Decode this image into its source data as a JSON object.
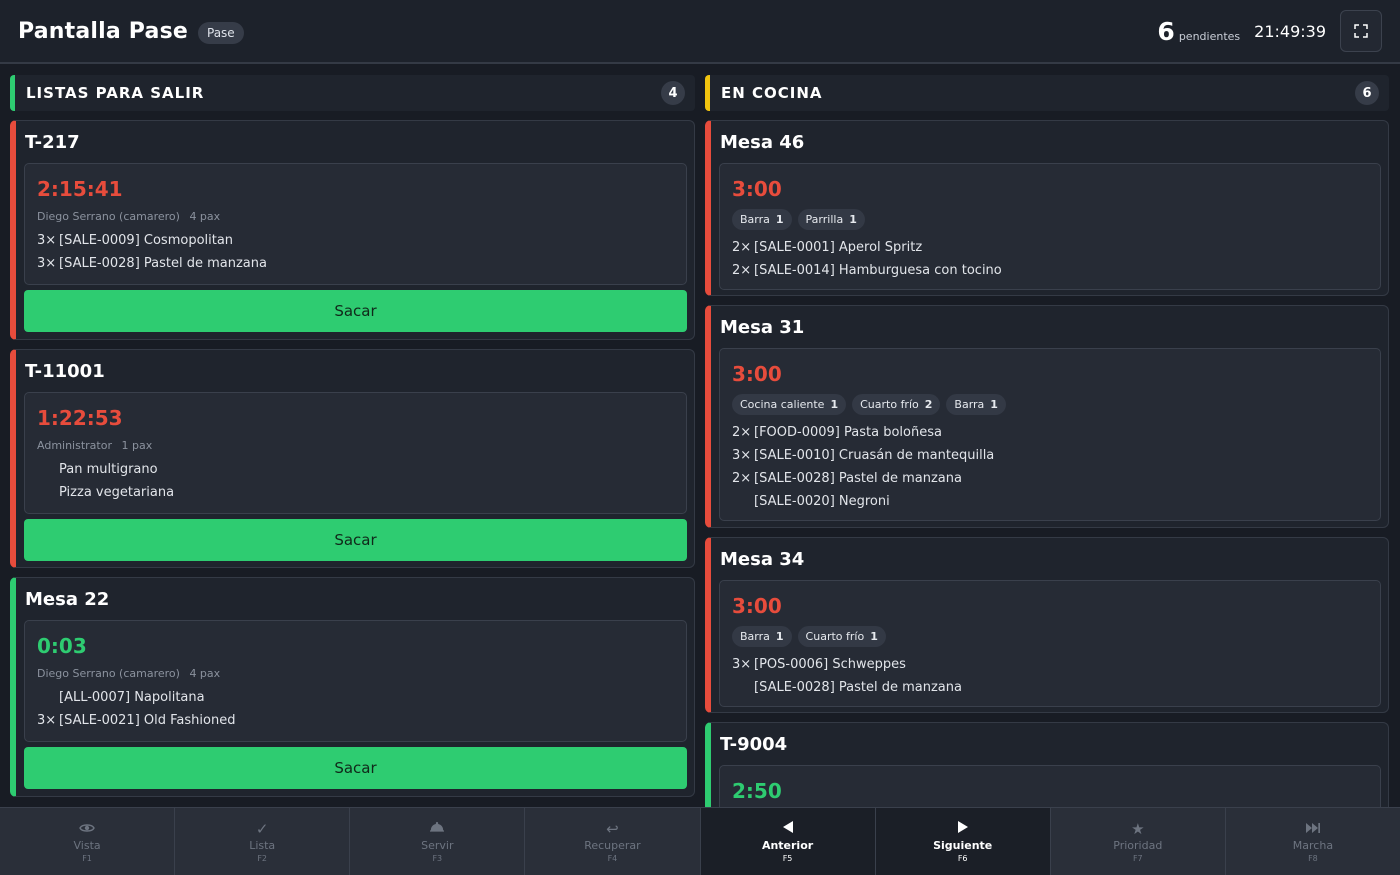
{
  "header": {
    "title": "Pantalla Pase",
    "mode_badge": "Pase",
    "pending_count": "6",
    "pending_label": "pendientes",
    "clock": "21:49:39",
    "fullscreen_icon": "fullscreen-icon"
  },
  "ready": {
    "title": "LISTAS PARA SALIR",
    "count": "4",
    "serve_label": "Sacar",
    "cards": [
      {
        "name": "T-217",
        "timer": "2:15:41",
        "waiter": "Diego Serrano (camarero)",
        "pax": "4 pax",
        "items": [
          {
            "qty": "3×",
            "text": "[SALE-0009] Cosmopolitan"
          },
          {
            "qty": "3×",
            "text": "[SALE-0028] Pastel de manzana"
          }
        ]
      },
      {
        "name": "T-11001",
        "timer": "1:22:53",
        "waiter": "Administrator",
        "pax": "1 pax",
        "items": [
          {
            "qty": "",
            "text": "Pan multigrano"
          },
          {
            "qty": "",
            "text": "Pizza vegetariana"
          }
        ]
      },
      {
        "name": "Mesa 22",
        "timer": "0:03",
        "waiter": "Diego Serrano (camarero)",
        "pax": "4 pax",
        "items": [
          {
            "qty": "",
            "text": "[ALL-0007] Napolitana"
          },
          {
            "qty": "3×",
            "text": "[SALE-0021] Old Fashioned"
          }
        ]
      }
    ]
  },
  "kitchen": {
    "title": "EN COCINA",
    "count": "6",
    "cards": [
      {
        "name": "Mesa 46",
        "timer": "3:00",
        "stations": [
          {
            "label": "Barra",
            "count": "1"
          },
          {
            "label": "Parrilla",
            "count": "1"
          }
        ],
        "items": [
          {
            "qty": "2×",
            "text": "[SALE-0001] Aperol Spritz"
          },
          {
            "qty": "2×",
            "text": "[SALE-0014] Hamburguesa con tocino"
          }
        ]
      },
      {
        "name": "Mesa 31",
        "timer": "3:00",
        "stations": [
          {
            "label": "Cocina caliente",
            "count": "1"
          },
          {
            "label": "Cuarto frío",
            "count": "2"
          },
          {
            "label": "Barra",
            "count": "1"
          }
        ],
        "items": [
          {
            "qty": "2×",
            "text": "[FOOD-0009] Pasta boloñesa"
          },
          {
            "qty": "3×",
            "text": "[SALE-0010] Cruasán de mantequilla"
          },
          {
            "qty": "2×",
            "text": "[SALE-0028] Pastel de manzana"
          },
          {
            "qty": "",
            "text": "[SALE-0020] Negroni"
          }
        ]
      },
      {
        "name": "Mesa 34",
        "timer": "3:00",
        "stations": [
          {
            "label": "Barra",
            "count": "1"
          },
          {
            "label": "Cuarto frío",
            "count": "1"
          }
        ],
        "items": [
          {
            "qty": "3×",
            "text": "[POS-0006] Schweppes"
          },
          {
            "qty": "",
            "text": "[SALE-0028] Pastel de manzana"
          }
        ]
      },
      {
        "name": "T-9004",
        "timer": "2:50"
      }
    ]
  },
  "bottom_bar": {
    "keys": [
      {
        "label": "Vista",
        "key": "F1",
        "icon": "eye-icon"
      },
      {
        "label": "Lista",
        "key": "F2",
        "icon": "check-icon"
      },
      {
        "label": "Servir",
        "key": "F3",
        "icon": "dish-icon"
      },
      {
        "label": "Recuperar",
        "key": "F4",
        "icon": "undo-icon"
      },
      {
        "label": "Anterior",
        "key": "F5",
        "icon": "triangle-left-icon"
      },
      {
        "label": "Siguiente",
        "key": "F6",
        "icon": "triangle-right-icon"
      },
      {
        "label": "Prioridad",
        "key": "F7",
        "icon": "star-icon"
      },
      {
        "label": "Marcha",
        "key": "F8",
        "icon": "skip-forward-icon"
      }
    ]
  },
  "colors": {
    "urgent": "#e74c3c",
    "ok": "#2ecc71",
    "kitchen_accent": "#f1c40f"
  }
}
